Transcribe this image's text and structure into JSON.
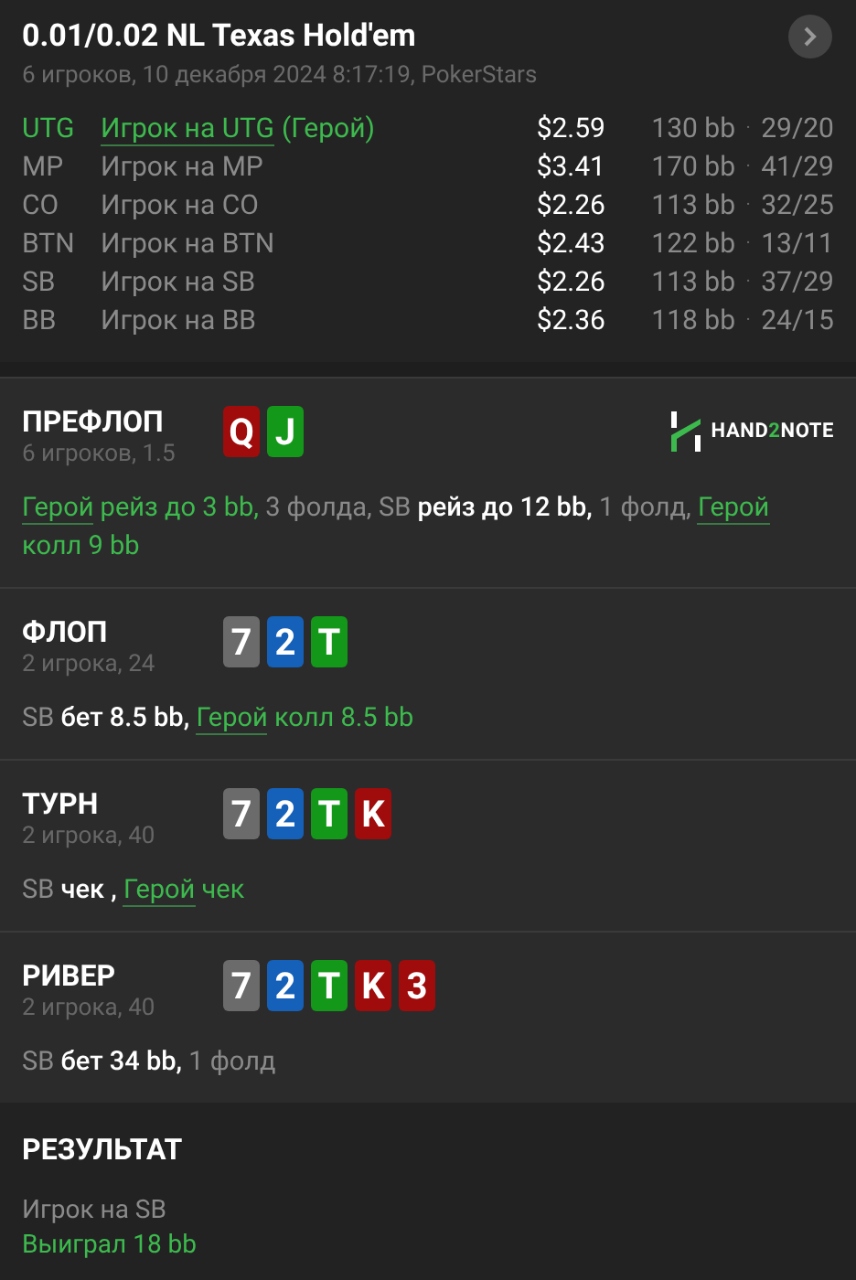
{
  "header": {
    "title": "0.01/0.02 NL Texas Hold'em",
    "subtitle": "6 игроков, 10 декабря 2024 8:17:19, PokerStars"
  },
  "players": [
    {
      "position": "UTG",
      "name": "Игрок на UTG",
      "hero_tag": "(Герой)",
      "hero": true,
      "stack": "$2.59",
      "bb": "130 bb",
      "sep": "·",
      "stats": "29/20"
    },
    {
      "position": "MP",
      "name": "Игрок на MP",
      "hero": false,
      "stack": "$3.41",
      "bb": "170 bb",
      "sep": "·",
      "stats": "41/29"
    },
    {
      "position": "CO",
      "name": "Игрок на CO",
      "hero": false,
      "stack": "$2.26",
      "bb": "113 bb",
      "sep": "·",
      "stats": "32/25"
    },
    {
      "position": "BTN",
      "name": "Игрок на BTN",
      "hero": false,
      "stack": "$2.43",
      "bb": "122 bb",
      "sep": "·",
      "stats": "13/11"
    },
    {
      "position": "SB",
      "name": "Игрок на SB",
      "hero": false,
      "stack": "$2.26",
      "bb": "113 bb",
      "sep": "·",
      "stats": "37/29"
    },
    {
      "position": "BB",
      "name": "Игрок на BB",
      "hero": false,
      "stack": "$2.36",
      "bb": "118 bb",
      "sep": "·",
      "stats": "24/15"
    }
  ],
  "streets": [
    {
      "name": "ПРЕФЛОП",
      "info": "6 игроков, 1.5",
      "cards": [
        {
          "rank": "Q",
          "color": "#a00c0c"
        },
        {
          "rank": "J",
          "color": "#13981a"
        }
      ],
      "logo": {
        "prefix": "HAND",
        "accent": "2",
        "suffix": "NOTE"
      },
      "actions": [
        {
          "kind": "hero",
          "text": "Герой"
        },
        {
          "kind": "hero_action",
          "text": " рейз до 3 bb,"
        },
        {
          "kind": "muted",
          "text": " 3 фолда, SB"
        },
        {
          "kind": "action",
          "text": " рейз до 12 bb,"
        },
        {
          "kind": "muted",
          "text": " 1 фолд, "
        },
        {
          "kind": "hero",
          "text": "Герой"
        },
        {
          "kind": "hero_action",
          "text": " колл 9 bb"
        }
      ]
    },
    {
      "name": "ФЛОП",
      "info": "2 игрока, 24",
      "cards": [
        {
          "rank": "7",
          "color": "#6b6b6b"
        },
        {
          "rank": "2",
          "color": "#1560b8"
        },
        {
          "rank": "T",
          "color": "#13981a"
        }
      ],
      "actions": [
        {
          "kind": "muted",
          "text": "SB"
        },
        {
          "kind": "action",
          "text": " бет 8.5 bb, "
        },
        {
          "kind": "hero",
          "text": "Герой"
        },
        {
          "kind": "hero_action",
          "text": " колл 8.5 bb"
        }
      ]
    },
    {
      "name": "ТУРН",
      "info": "2 игрока, 40",
      "cards": [
        {
          "rank": "7",
          "color": "#6b6b6b"
        },
        {
          "rank": "2",
          "color": "#1560b8"
        },
        {
          "rank": "T",
          "color": "#13981a"
        },
        {
          "rank": "K",
          "color": "#a00c0c"
        }
      ],
      "actions": [
        {
          "kind": "muted",
          "text": "SB"
        },
        {
          "kind": "action",
          "text": " чек , "
        },
        {
          "kind": "hero",
          "text": "Герой"
        },
        {
          "kind": "hero_action",
          "text": " чек"
        }
      ]
    },
    {
      "name": "РИВЕР",
      "info": "2 игрока, 40",
      "cards": [
        {
          "rank": "7",
          "color": "#6b6b6b"
        },
        {
          "rank": "2",
          "color": "#1560b8"
        },
        {
          "rank": "T",
          "color": "#13981a"
        },
        {
          "rank": "K",
          "color": "#a00c0c"
        },
        {
          "rank": "3",
          "color": "#a00c0c"
        }
      ],
      "actions": [
        {
          "kind": "muted",
          "text": "SB"
        },
        {
          "kind": "action",
          "text": " бет 34 bb,"
        },
        {
          "kind": "muted",
          "text": " 1 фолд"
        }
      ]
    }
  ],
  "result": {
    "title": "РЕЗУЛЬТАТ",
    "player": "Игрок на SB",
    "outcome": "Выиграл 18 bb"
  }
}
